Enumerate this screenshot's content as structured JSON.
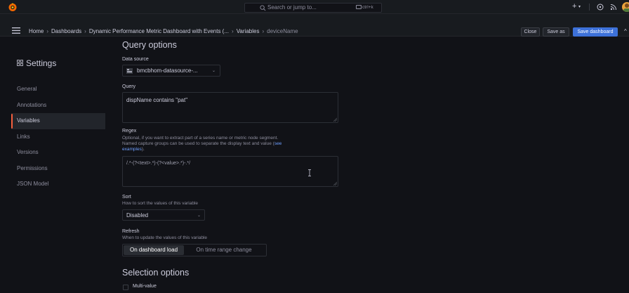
{
  "topbar": {
    "search_placeholder": "Search or jump to...",
    "search_shortcut": "ctrl+k",
    "plus_label": "+",
    "brand_color": "#f46800",
    "primary_button_color": "#3d71d9"
  },
  "breadcrumb": {
    "items": [
      "Home",
      "Dashboards",
      "Dynamic Performance Metric Dashboard with Events (...",
      "Variables",
      "deviceName"
    ],
    "separator": "›"
  },
  "actions": {
    "close_label": "Close",
    "save_as_label": "Save as",
    "save_dashboard_label": "Save dashboard"
  },
  "sidebar": {
    "title": "Settings",
    "items": [
      {
        "label": "General"
      },
      {
        "label": "Annotations"
      },
      {
        "label": "Variables",
        "active": true
      },
      {
        "label": "Links"
      },
      {
        "label": "Versions"
      },
      {
        "label": "Permissions"
      },
      {
        "label": "JSON Model"
      }
    ]
  },
  "query_options": {
    "heading": "Query options",
    "data_source_label": "Data source",
    "data_source_value": "bmcbhom-datasource-...",
    "query_label": "Query",
    "query_value": "dispName contains \"pat\"",
    "regex_label": "Regex",
    "regex_description_1": "Optional, if you want to extract part of a series name or metric node segment.",
    "regex_description_2": "Named capture groups can be used to separate the display text and value (",
    "regex_link_1": "see",
    "regex_link_2": "examples",
    "regex_description_3": ").",
    "regex_value": "/.*-(?<text>.*)-(?<value>.*)-.*/",
    "sort_label": "Sort",
    "sort_description": "How to sort the values of this variable",
    "sort_value": "Disabled",
    "refresh_label": "Refresh",
    "refresh_description": "When to update the values of this variable",
    "refresh_options": [
      "On dashboard load",
      "On time range change"
    ],
    "refresh_selected": "On dashboard load"
  },
  "selection_options": {
    "heading": "Selection options",
    "multi_value_label": "Multi-value",
    "multi_value_checked": false
  }
}
